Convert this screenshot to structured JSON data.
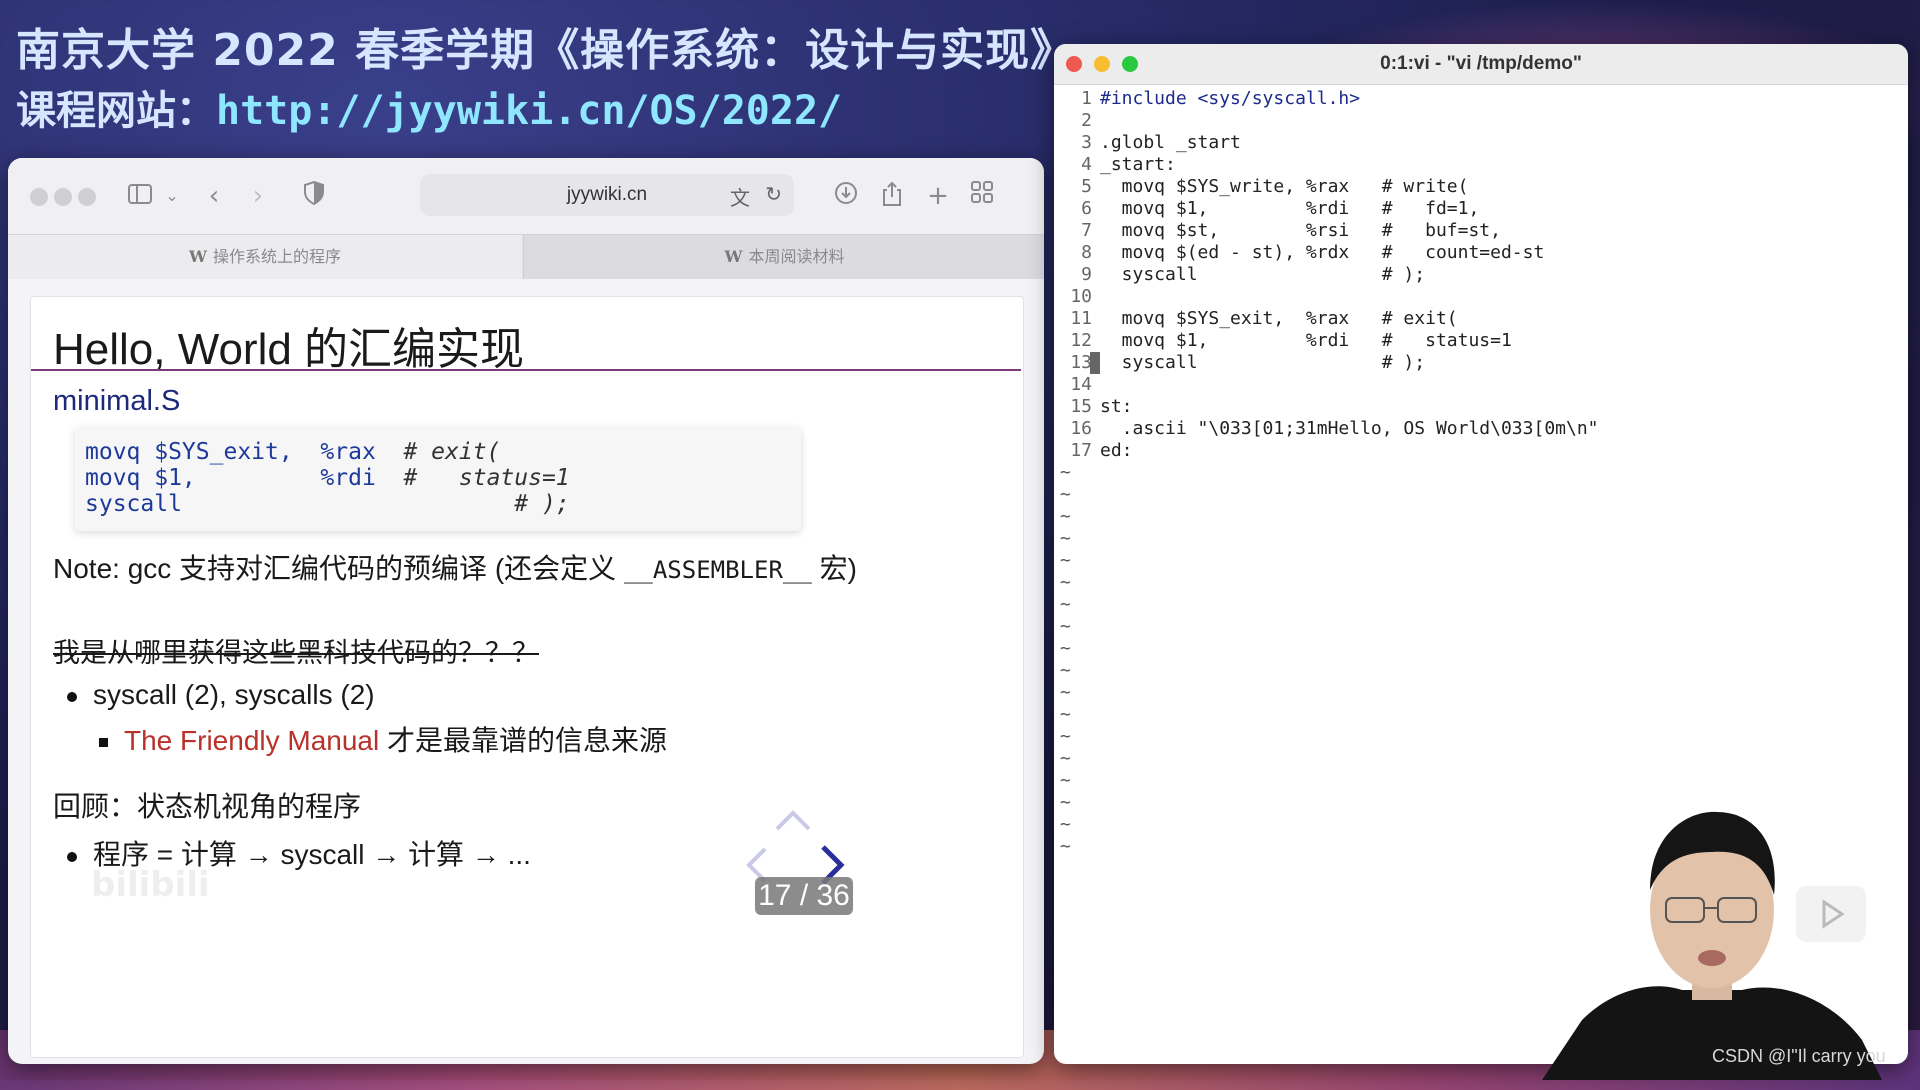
{
  "course": {
    "title": "南京大学 2022 春季学期《操作系统：设计与实现》",
    "site_label": "课程网站：",
    "site_url": "http://jyywiki.cn/OS/2022/"
  },
  "browser": {
    "address": "jyywiki.cn",
    "tabs": [
      {
        "label": "操作系统上的程序"
      },
      {
        "label": "本周阅读材料"
      }
    ]
  },
  "slide": {
    "title": "Hello, World 的汇编实现",
    "filename": "minimal.S",
    "code": [
      {
        "kw": "movq $SYS_exit,  %rax",
        "cm": "  # exit("
      },
      {
        "kw": "movq $1,         %rdi",
        "cm": "  #   status=1"
      },
      {
        "kw": "syscall",
        "cm": "                        # );"
      }
    ],
    "note_prefix": "Note: gcc 支持对汇编代码的预编译 (还会定义 ",
    "note_macro": "__ASSEMBLER__",
    "note_suffix": " 宏)",
    "strike_question": "我是从哪里获得这些黑科技代码的？？？",
    "bullet1": "syscall (2), syscalls (2)",
    "bullet2_link": "The Friendly Manual",
    "bullet2_rest": " 才是最靠谱的信息来源",
    "review": "回顾：状态机视角的程序",
    "bullet3": "程序 = 计算 → syscall → 计算 → ...",
    "slide_number": "17 / 36",
    "watermark": "bilibili"
  },
  "terminal": {
    "title": "0:1:vi - \"vi /tmp/demo\"",
    "lines": [
      {
        "n": "1",
        "t": "#include <sys/syscall.h>"
      },
      {
        "n": "2",
        "t": ""
      },
      {
        "n": "3",
        "t": ".globl _start"
      },
      {
        "n": "4",
        "t": "_start:"
      },
      {
        "n": "5",
        "t": "  movq $SYS_write, %rax   # write("
      },
      {
        "n": "6",
        "t": "  movq $1,         %rdi   #   fd=1,"
      },
      {
        "n": "7",
        "t": "  movq $st,        %rsi   #   buf=st,"
      },
      {
        "n": "8",
        "t": "  movq $(ed - st), %rdx   #   count=ed-st"
      },
      {
        "n": "9",
        "t": "  syscall                 # );"
      },
      {
        "n": "10",
        "t": ""
      },
      {
        "n": "11",
        "t": "  movq $SYS_exit,  %rax   # exit("
      },
      {
        "n": "12",
        "t": "  movq $1,         %rdi   #   status=1"
      },
      {
        "n": "13",
        "t": "  syscall                 # );"
      },
      {
        "n": "14",
        "t": ""
      },
      {
        "n": "15",
        "t": "st:"
      },
      {
        "n": "16",
        "t": "  .ascii \"\\033[01;31mHello, OS World\\033[0m\\n\""
      },
      {
        "n": "17",
        "t": "ed:"
      }
    ],
    "tilde": "~",
    "tilde_count": 18
  },
  "csdn_watermark": "CSDN @I\"Il  carry  you"
}
